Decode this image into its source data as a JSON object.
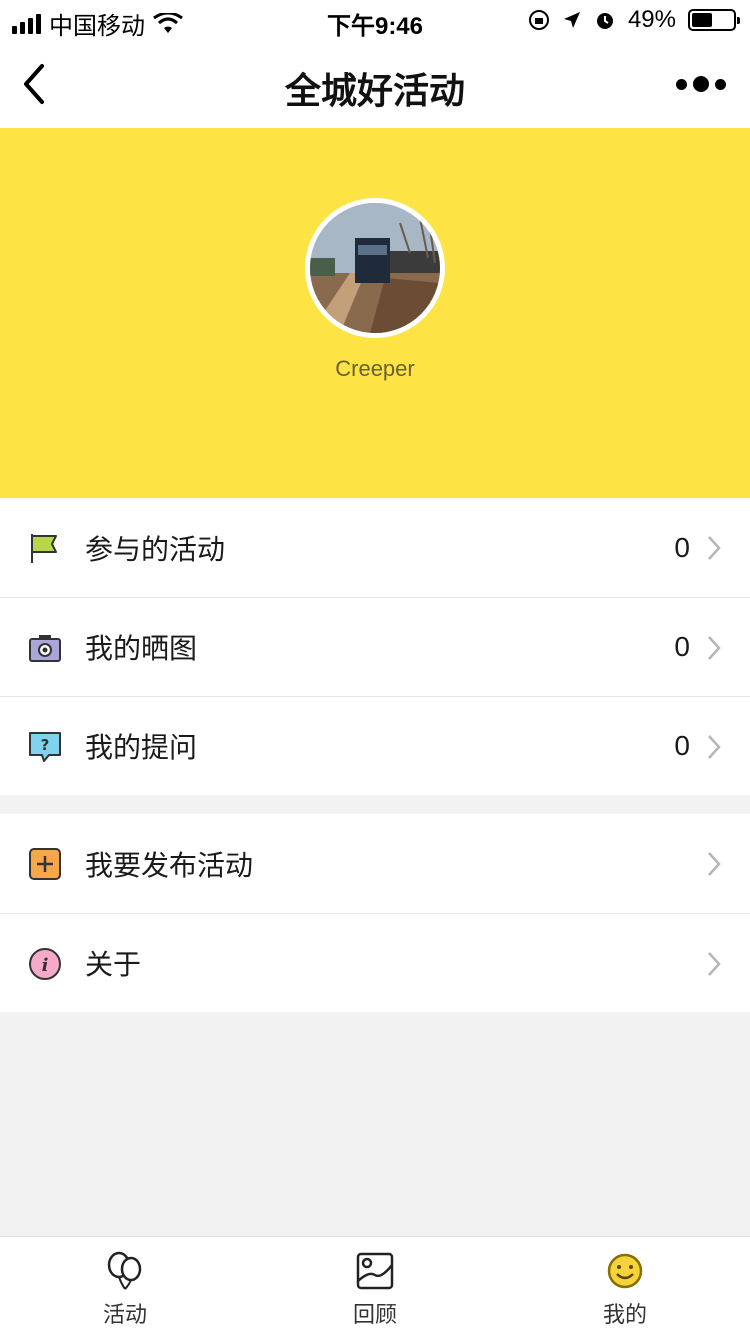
{
  "status_bar": {
    "carrier": "中国移动",
    "time": "下午9:46",
    "battery_percent": "49%",
    "battery_level": 0.49
  },
  "nav": {
    "title": "全城好活动",
    "back_icon": "chevron-left-icon",
    "more_icon": "more-dots-icon"
  },
  "profile": {
    "username": "Creeper",
    "header_color": "#fde343"
  },
  "menu_group_1": [
    {
      "label": "参与的活动",
      "count": "0",
      "icon": "flag-icon"
    },
    {
      "label": "我的晒图",
      "count": "0",
      "icon": "camera-icon"
    },
    {
      "label": "我的提问",
      "count": "0",
      "icon": "question-bubble-icon"
    }
  ],
  "menu_group_2": [
    {
      "label": "我要发布活动",
      "icon": "add-square-icon"
    },
    {
      "label": "关于",
      "icon": "info-icon"
    }
  ],
  "tabbar": [
    {
      "label": "活动",
      "icon": "balloons-icon"
    },
    {
      "label": "回顾",
      "icon": "gallery-icon"
    },
    {
      "label": "我的",
      "icon": "smile-icon"
    }
  ]
}
